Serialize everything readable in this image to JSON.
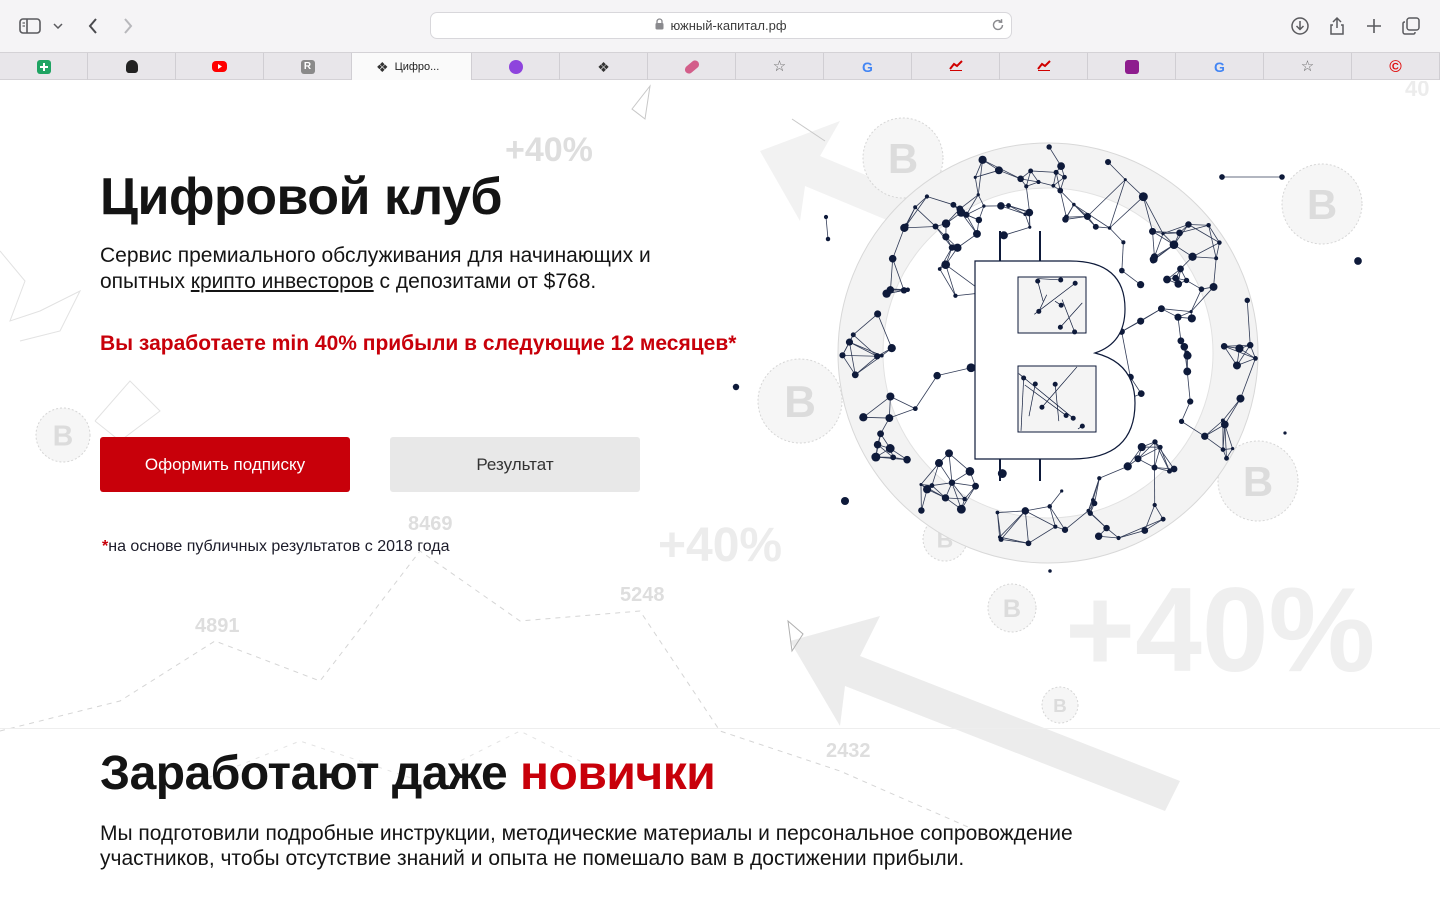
{
  "browser": {
    "url": "южный-капитал.рф",
    "tabs": [
      {
        "favicon": "green-plus-icon",
        "color": "#1fa463",
        "label": ""
      },
      {
        "favicon": "person-icon",
        "color": "#333333",
        "label": ""
      },
      {
        "favicon": "youtube-icon",
        "color": "#ff0000",
        "label": ""
      },
      {
        "favicon": "r-icon",
        "color": "#8a8a8a",
        "label": ""
      },
      {
        "favicon": "clover-icon",
        "color": "#333333",
        "label": "Цифро..."
      },
      {
        "favicon": "purple-circle-icon",
        "color": "#8e44dd",
        "label": ""
      },
      {
        "favicon": "clover-icon",
        "color": "#333333",
        "label": ""
      },
      {
        "favicon": "pill-icon",
        "color": "#d35e8a",
        "label": ""
      },
      {
        "favicon": "star-icon",
        "color": "#666666",
        "label": ""
      },
      {
        "favicon": "google-icon",
        "color": "#4285f4",
        "label": ""
      },
      {
        "favicon": "trend-icon",
        "color": "#d00000",
        "label": ""
      },
      {
        "favicon": "trend-icon",
        "color": "#d00000",
        "label": ""
      },
      {
        "favicon": "purple-square-icon",
        "color": "#8e1d8e",
        "label": ""
      },
      {
        "favicon": "google-icon",
        "color": "#4285f4",
        "label": ""
      },
      {
        "favicon": "star-icon",
        "color": "#666666",
        "label": ""
      },
      {
        "favicon": "copyright-icon",
        "color": "#e01010",
        "label": ""
      }
    ]
  },
  "hero": {
    "title": "Цифровой клуб",
    "subtitle_before": "Сервис премиального обслуживания для начинающих и опытных ",
    "subtitle_link": "крипто инвесторов",
    "subtitle_after": " с депозитами от $768.",
    "promo": "Вы заработаете min 40% прибыли в следующие 12 месяцев",
    "promo_star": "*",
    "primary_button": "Оформить подписку",
    "secondary_button": "Результат",
    "footnote_star": "*",
    "footnote": "на основе публичных результатов с 2018 года"
  },
  "background": {
    "labels": [
      "+40%",
      "+40%",
      "+40%",
      "40",
      "8469",
      "5248",
      "4891",
      "2432"
    ]
  },
  "section2": {
    "title_plain": "Заработают даже ",
    "title_accent": "новички",
    "text": "Мы подготовили подробные инструкции, методические материалы и персональное сопровождение участников, чтобы отсутствие знаний и опыта не помешало вам в достижении прибыли."
  },
  "colors": {
    "accent": "#c8000a",
    "network": "#0e1a3a"
  }
}
